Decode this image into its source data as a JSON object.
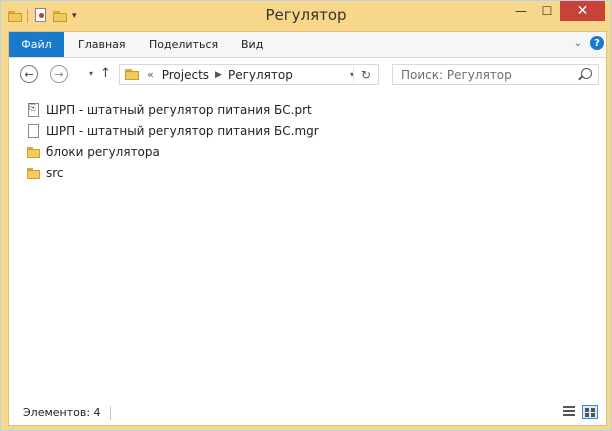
{
  "window": {
    "title": "Регулятор"
  },
  "ribbon": {
    "tabs": [
      "Файл",
      "Главная",
      "Поделиться",
      "Вид"
    ]
  },
  "nav": {
    "breadcrumb": {
      "overflow": "«",
      "items": [
        "Projects",
        "Регулятор"
      ]
    },
    "search_placeholder": "Поиск: Регулятор"
  },
  "files": [
    {
      "name": "ШРП - штатный регулятор питания БС.prt",
      "type": "prt-file"
    },
    {
      "name": "ШРП - штатный регулятор питания БС.mgr",
      "type": "file"
    },
    {
      "name": "блоки регулятора",
      "type": "folder"
    },
    {
      "name": "src",
      "type": "folder"
    }
  ],
  "status": {
    "item_count": "Элементов: 4"
  },
  "colors": {
    "accent": "#1979ca",
    "frame": "#f8d68a",
    "close": "#c7433a"
  }
}
